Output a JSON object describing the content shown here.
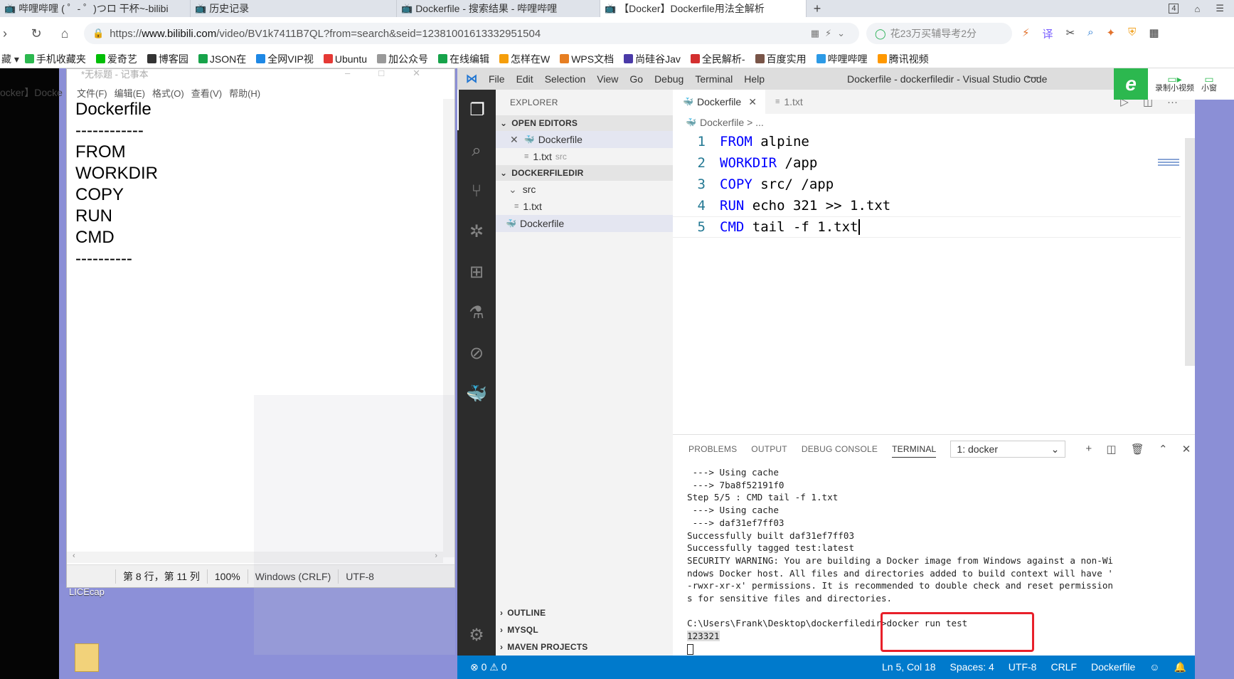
{
  "browser": {
    "tabs": [
      {
        "label": "哔哩哔哩 ( ゜- ゜)つロ 干杯~-bilibi",
        "active": false
      },
      {
        "label": "历史记录",
        "active": false
      },
      {
        "label": "Dockerfile - 搜索结果 - 哔哩哔哩",
        "active": false
      },
      {
        "label": "【Docker】Dockerfile用法全解析",
        "active": true
      }
    ],
    "tab_count": "4",
    "url_prefix": "https://",
    "url_domain": "www.bilibili.com",
    "url_path": "/video/BV1k7411B7QL?from=search&seid=12381001613332951504",
    "search_text": "花23万买辅导考2分",
    "bookmarks": [
      {
        "label": "手机收藏夹",
        "color": "#2cb84f"
      },
      {
        "label": "爱奇艺",
        "color": "#00be06"
      },
      {
        "label": "博客园",
        "color": "#333333"
      },
      {
        "label": "JSON在",
        "color": "#17a34a"
      },
      {
        "label": "全网VIP视",
        "color": "#1e88e5"
      },
      {
        "label": "Ubuntu",
        "color": "#e53935"
      },
      {
        "label": "加公众号",
        "color": "#999999"
      },
      {
        "label": "在线编辑",
        "color": "#16a34a"
      },
      {
        "label": "怎样在W",
        "color": "#f59e0b"
      },
      {
        "label": "WPS文档",
        "color": "#e67e22"
      },
      {
        "label": "尚硅谷Jav",
        "color": "#4a3aa8"
      },
      {
        "label": "全民解析-",
        "color": "#d32f2f"
      },
      {
        "label": "百度实用",
        "color": "#795548"
      },
      {
        "label": "哔哩哔哩",
        "color": "#2c9ae6"
      },
      {
        "label": "腾讯视频",
        "color": "#ff9800"
      }
    ]
  },
  "desktop": {
    "side_ghost": "ocker】Docke",
    "licecap_label": "LICEcap"
  },
  "notepad": {
    "title": "*无标题 - 记事本",
    "menu": [
      "文件(F)",
      "编辑(E)",
      "格式(O)",
      "查看(V)",
      "帮助(H)"
    ],
    "lines": [
      "Dockerfile",
      "------------",
      "FROM",
      "WORKDIR",
      "COPY",
      "RUN",
      "CMD",
      "----------"
    ],
    "status": {
      "position": "第 8 行，第 11 列",
      "zoom": "100%",
      "eol": "Windows (CRLF)",
      "encoding": "UTF-8"
    }
  },
  "vscode": {
    "menu": [
      "File",
      "Edit",
      "Selection",
      "View",
      "Go",
      "Debug",
      "Terminal",
      "Help"
    ],
    "window_title": "Dockerfile - dockerfiledir - Visual Studio Code",
    "explorer_title": "EXPLORER",
    "open_editors_title": "OPEN EDITORS",
    "open_editors": [
      {
        "label": "Dockerfile",
        "sub": ""
      },
      {
        "label": "1.txt",
        "sub": "src"
      }
    ],
    "folder_title": "DOCKERFILEDIR",
    "tree": [
      {
        "label": "src"
      },
      {
        "label": "1.txt"
      },
      {
        "label": "Dockerfile"
      }
    ],
    "bottom_sections": [
      "OUTLINE",
      "MYSQL",
      "MAVEN PROJECTS"
    ],
    "editor_tabs": [
      "Dockerfile",
      "1.txt"
    ],
    "breadcrumb": "Dockerfile > ...",
    "code": [
      {
        "n": "1",
        "kw": "FROM",
        "rest": " alpine"
      },
      {
        "n": "2",
        "kw": "WORKDIR",
        "rest": " /app"
      },
      {
        "n": "3",
        "kw": "COPY",
        "rest": " src/ /app"
      },
      {
        "n": "4",
        "kw": "RUN",
        "rest": " echo 321 >> 1.txt"
      },
      {
        "n": "5",
        "kw": "CMD",
        "rest": " tail -f 1.txt"
      }
    ],
    "panel_tabs": [
      "PROBLEMS",
      "OUTPUT",
      "DEBUG CONSOLE",
      "TERMINAL"
    ],
    "terminal_select": "1: docker",
    "terminal_lines": [
      " ---> Using cache",
      " ---> 7ba8f52191f0",
      "Step 5/5 : CMD tail -f 1.txt",
      " ---> Using cache",
      " ---> daf31ef7ff03",
      "Successfully built daf31ef7ff03",
      "Successfully tagged test:latest",
      "SECURITY WARNING: You are building a Docker image from Windows against a non-Wi",
      "ndows Docker host. All files and directories added to build context will have '",
      "-rwxr-xr-x' permissions. It is recommended to double check and reset permission",
      "s for sensitive files and directories.",
      "",
      "C:\\Users\\Frank\\Desktop\\dockerfiledir>docker run test"
    ],
    "terminal_output": "123321",
    "status": {
      "errors": "0",
      "warnings": "0",
      "position": "Ln 5, Col 18",
      "spaces": "Spaces: 4",
      "encoding": "UTF-8",
      "eol": "CRLF",
      "language": "Dockerfile"
    }
  },
  "float_widget": {
    "record_label": "录制小视频",
    "small_label": "小窗"
  }
}
